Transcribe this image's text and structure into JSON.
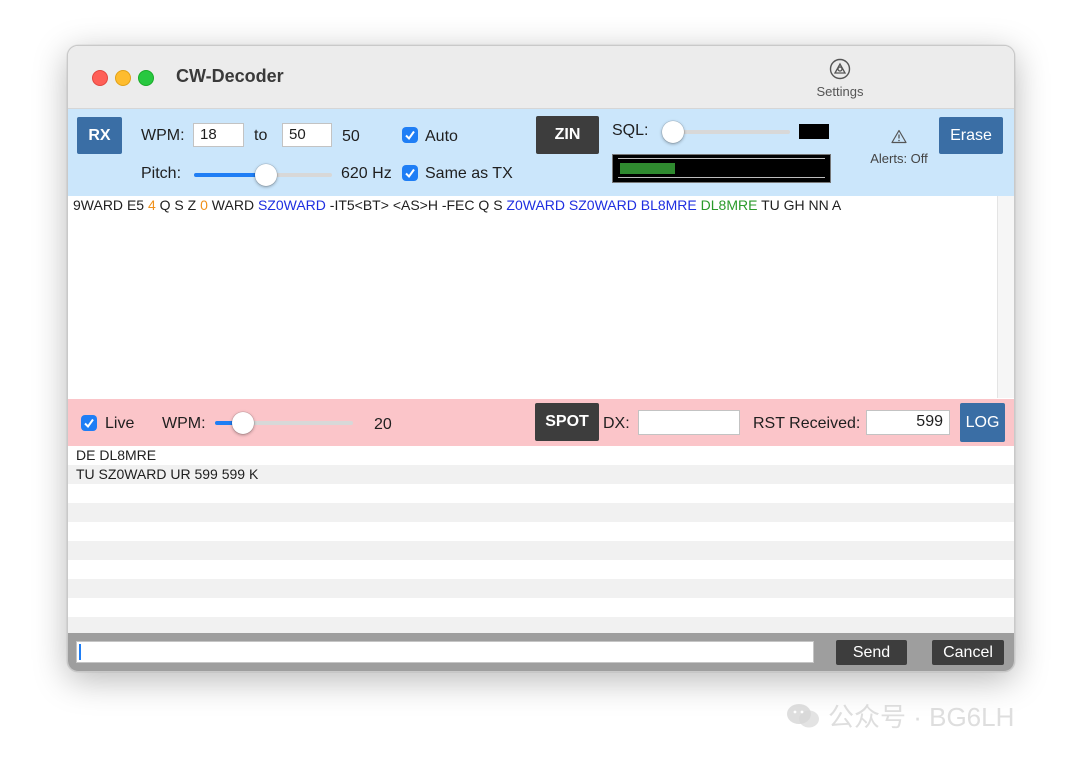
{
  "window": {
    "title": "CW-Decoder",
    "settings_label": "Settings"
  },
  "rx_panel": {
    "rx_button": "RX",
    "wpm_label": "WPM:",
    "wpm_from": "18",
    "to_label": "to",
    "wpm_to": "50",
    "wpm_current": "50",
    "auto_label": "Auto",
    "auto_checked": true,
    "zin_button": "ZIN",
    "sql_label": "SQL:",
    "sql_level": 0.0,
    "pitch_label": "Pitch:",
    "pitch_value": "620 Hz",
    "pitch_level": 0.52,
    "same_as_tx_label": "Same as TX",
    "same_as_tx_checked": true,
    "signal_level": 0.27,
    "alerts_label": "Alerts: Off",
    "erase_button": "Erase"
  },
  "decoded_tokens": [
    {
      "text": "9WARD",
      "color": "#1f1f1f"
    },
    {
      "text": "E5",
      "color": "#1f1f1f"
    },
    {
      "text": "4",
      "color": "#f0901a"
    },
    {
      "text": "Q",
      "color": "#1f1f1f"
    },
    {
      "text": "S",
      "color": "#1f1f1f"
    },
    {
      "text": "Z",
      "color": "#1f1f1f"
    },
    {
      "text": "0",
      "color": "#f0901a"
    },
    {
      "text": "WARD",
      "color": "#1f1f1f"
    },
    {
      "text": "SZ0WARD",
      "color": "#1e2ee0"
    },
    {
      "text": "-IT5<BT>",
      "color": "#1f1f1f"
    },
    {
      "text": "<AS>H",
      "color": "#1f1f1f"
    },
    {
      "text": "-FEC",
      "color": "#1f1f1f"
    },
    {
      "text": "Q",
      "color": "#1f1f1f"
    },
    {
      "text": "S",
      "color": "#1f1f1f"
    },
    {
      "text": "Z0WARD",
      "color": "#1e2ee0"
    },
    {
      "text": "SZ0WARD",
      "color": "#1e2ee0"
    },
    {
      "text": "BL8MRE",
      "color": "#1e2ee0"
    },
    {
      "text": "DL8MRE",
      "color": "#2a9a2a"
    },
    {
      "text": "TU",
      "color": "#1f1f1f"
    },
    {
      "text": "GH",
      "color": "#1f1f1f"
    },
    {
      "text": "NN",
      "color": "#1f1f1f"
    },
    {
      "text": "A",
      "color": "#1f1f1f"
    }
  ],
  "tx_panel": {
    "live_label": "Live",
    "live_checked": true,
    "wpm_label": "WPM:",
    "wpm_value": "20",
    "wpm_level": 0.2,
    "spot_button": "SPOT",
    "dx_label": "DX:",
    "dx_value": "",
    "rst_label": "RST Received:",
    "rst_value": "599",
    "log_button": "LOG"
  },
  "log_lines": [
    "DE DL8MRE",
    "TU SZ0WARD UR 599 599 K",
    "",
    "",
    "",
    "",
    "",
    "",
    "",
    ""
  ],
  "bottom_bar": {
    "send_value": "",
    "send_button": "Send",
    "cancel_button": "Cancel"
  },
  "watermark": "公众号 · BG6LH",
  "colors": {
    "rx_panel_bg": "#cbe6fb",
    "tx_panel_bg": "#fbc5c9",
    "accent": "#1f7ef5",
    "button_blue": "#3a6ea5",
    "button_dark": "#3d3d3d"
  }
}
